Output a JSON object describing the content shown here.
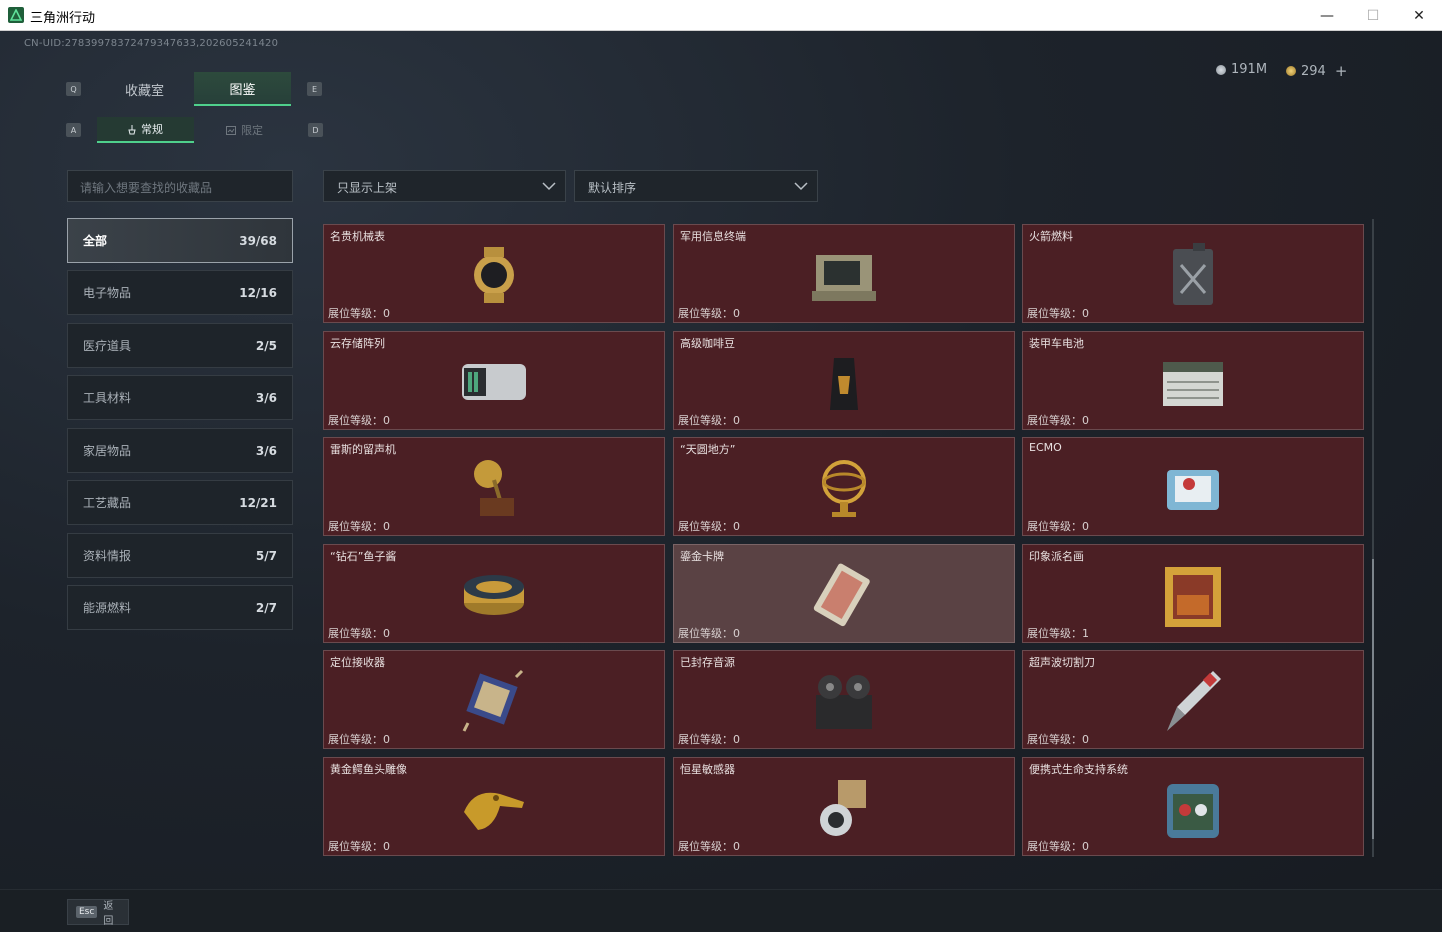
{
  "window": {
    "title": "三角洲行动",
    "minimize": "—",
    "maximize": "☐",
    "close": "✕"
  },
  "uid": "CN-UID:27839978372479347633,202605241420",
  "currency": {
    "silver": "191M",
    "gold": "294",
    "add": "+"
  },
  "keys": {
    "q": "Q",
    "e": "E",
    "a": "A",
    "d": "D",
    "esc": "Esc"
  },
  "tabs": [
    {
      "label": "收藏室",
      "active": false
    },
    {
      "label": "图鉴",
      "active": true
    }
  ],
  "subtabs": [
    {
      "label": "常规",
      "active": true
    },
    {
      "label": "限定",
      "active": false
    }
  ],
  "search": {
    "placeholder": "请输入想要查找的收藏品"
  },
  "filters": {
    "display": "只显示上架",
    "sort": "默认排序"
  },
  "categories": [
    {
      "label": "全部",
      "count": "39/68",
      "active": true
    },
    {
      "label": "电子物品",
      "count": "12/16"
    },
    {
      "label": "医疗道具",
      "count": "2/5"
    },
    {
      "label": "工具材料",
      "count": "3/6"
    },
    {
      "label": "家居物品",
      "count": "3/6"
    },
    {
      "label": "工艺藏品",
      "count": "12/21"
    },
    {
      "label": "资料情报",
      "count": "5/7"
    },
    {
      "label": "能源燃料",
      "count": "2/7"
    }
  ],
  "level_label": "展位等级：",
  "items": [
    {
      "name": "名贵机械表",
      "level": "0",
      "icon": "watch-icon"
    },
    {
      "name": "军用信息终端",
      "level": "0",
      "icon": "terminal-icon"
    },
    {
      "name": "火箭燃料",
      "level": "0",
      "icon": "fuel-can-icon"
    },
    {
      "name": "云存储阵列",
      "level": "0",
      "icon": "storage-array-icon"
    },
    {
      "name": "高级咖啡豆",
      "level": "0",
      "icon": "coffee-bag-icon"
    },
    {
      "name": "装甲车电池",
      "level": "0",
      "icon": "battery-icon"
    },
    {
      "name": "雷斯的留声机",
      "level": "0",
      "icon": "gramophone-icon"
    },
    {
      "name": "“天圆地方”",
      "level": "0",
      "icon": "armillary-sphere-icon"
    },
    {
      "name": "ECMO",
      "level": "0",
      "icon": "ecmo-icon"
    },
    {
      "name": "“钻石”鱼子酱",
      "level": "0",
      "icon": "caviar-tin-icon"
    },
    {
      "name": "鎏金卡牌",
      "level": "0",
      "icon": "gold-card-icon",
      "highlight": true
    },
    {
      "name": "印象派名画",
      "level": "1",
      "icon": "painting-icon"
    },
    {
      "name": "定位接收器",
      "level": "0",
      "icon": "receiver-icon"
    },
    {
      "name": "已封存音源",
      "level": "0",
      "icon": "reel-recorder-icon"
    },
    {
      "name": "超声波切割刀",
      "level": "0",
      "icon": "ultrasonic-knife-icon"
    },
    {
      "name": "黄金鳄鱼头雕像",
      "level": "0",
      "icon": "croc-statue-icon"
    },
    {
      "name": "恒星敏感器",
      "level": "0",
      "icon": "star-sensor-icon"
    },
    {
      "name": "便携式生命支持系统",
      "level": "0",
      "icon": "life-support-icon"
    }
  ],
  "back_label": "返回",
  "colors": {
    "accent": "#4fd08c",
    "card_bg": "#4b1f24"
  }
}
